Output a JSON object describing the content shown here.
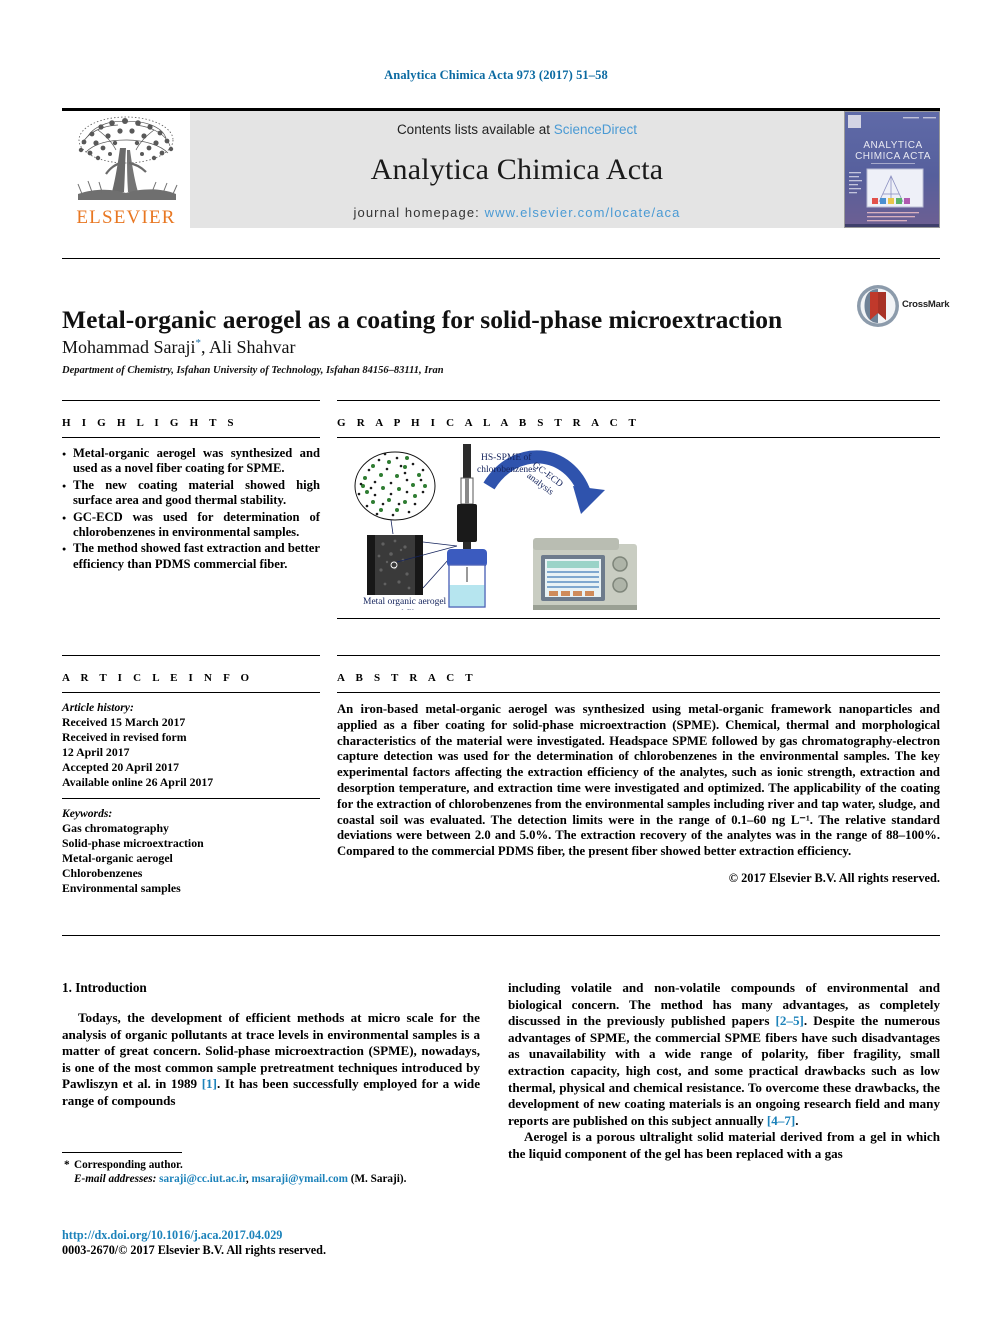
{
  "running_head": "Analytica Chimica Acta 973 (2017) 51–58",
  "masthead": {
    "publisher": "ELSEVIER",
    "contents_prefix": "Contents lists available at ",
    "contents_link": "ScienceDirect",
    "journal_title": "Analytica Chimica Acta",
    "homepage_prefix": "journal homepage: ",
    "homepage_url": "www.elsevier.com/locate/aca",
    "cover_title_line1": "ANALYTICA",
    "cover_title_line2": "CHIMICA ACTA"
  },
  "title": "Metal-organic aerogel as a coating for solid-phase microextraction",
  "authors": "Mohammad Saraji",
  "authors_rest": ", Ali Shahvar",
  "author_marker": "*",
  "affiliation": "Department of Chemistry, Isfahan University of Technology, Isfahan 84156–83111, Iran",
  "crossmark": {
    "label": "CrossMark"
  },
  "sections": {
    "highlights": "H I G H L I G H T S",
    "graphical_abstract": "G R A P H I C A L   A B S T R A C T",
    "article_info": "A R T I C L E   I N F O",
    "abstract": "A B S T R A C T"
  },
  "highlights": [
    "Metal-organic aerogel was synthesized and used as a novel fiber coating for SPME.",
    "The new coating material showed high surface area and good thermal stability.",
    "GC-ECD was used for determination of chlorobenzenes in environmental samples.",
    "The method showed fast extraction and better efficiency than PDMS commercial fiber."
  ],
  "graphical_abstract_figure": {
    "label_hs_spme_line1": "HS-SPME of",
    "label_hs_spme_line2": "chlorobenzenes",
    "label_arrow_line1": "GC-ECD",
    "label_arrow_line2": "analysis",
    "label_fiber_line1": "Metal organic aerogel",
    "label_fiber_line2": "coated fiber"
  },
  "article_info": {
    "history_label": "Article history:",
    "history": [
      "Received 15 March 2017",
      "Received in revised form",
      "12 April 2017",
      "Accepted 20 April 2017",
      "Available online 26 April 2017"
    ],
    "keywords_label": "Keywords:",
    "keywords": [
      "Gas chromatography",
      "Solid-phase microextraction",
      "Metal-organic aerogel",
      "Chlorobenzenes",
      "Environmental samples"
    ]
  },
  "abstract": {
    "text": "An iron-based metal-organic aerogel was synthesized using metal-organic framework nanoparticles and applied as a fiber coating for solid-phase microextraction (SPME). Chemical, thermal and morphological characteristics of the material were investigated. Headspace SPME followed by gas chromatography-electron capture detection was used for the determination of chlorobenzenes in the environmental samples. The key experimental factors affecting the extraction efficiency of the analytes, such as ionic strength, extraction and desorption temperature, and extraction time were investigated and optimized. The applicability of the coating for the extraction of chlorobenzenes from the environmental samples including river and tap water, sludge, and coastal soil was evaluated. The detection limits were in the range of 0.1–60 ng L⁻¹. The relative standard deviations were between 2.0 and 5.0%. The extraction recovery of the analytes was in the range of 88–100%. Compared to the commercial PDMS fiber, the present fiber showed better extraction efficiency.",
    "copyright": "© 2017 Elsevier B.V. All rights reserved."
  },
  "body": {
    "intro_heading": "1. Introduction",
    "left_para_1_a": "Todays, the development of efficient methods at micro scale for the analysis of organic pollutants at trace levels in environmental samples is a matter of great concern. Solid-phase microextraction (SPME), nowadays, is one of the most common sample pretreatment techniques introduced by Pawliszyn et al. in 1989 ",
    "left_cite_1": "[1]",
    "left_para_1_b": ". It has been successfully employed for a wide range of compounds",
    "right_para_1_a": "including volatile and non-volatile compounds of environmental and biological concern. The method has many advantages, as completely discussed in the previously published papers ",
    "right_cite_1": "[2–5]",
    "right_para_1_b": ". Despite the numerous advantages of SPME, the commercial SPME fibers have such disadvantages as unavailability with a wide range of polarity, fiber fragility, small extraction capacity, high cost, and some practical drawbacks such as low thermal, physical and chemical resistance. To overcome these drawbacks, the development of new coating materials is an ongoing research field and many reports are published on this subject annually ",
    "right_cite_2": "[4–7]",
    "right_para_1_c": ".",
    "right_para_2": "Aerogel is a porous ultralight solid material derived from a gel in which the liquid component of the gel has been replaced with a gas"
  },
  "footnote": {
    "corresponding": "Corresponding author.",
    "email_label": "E-mail addresses:",
    "email_1": "saraji@cc.iut.ac.ir",
    "email_sep": ", ",
    "email_2": "msaraji@ymail.com",
    "email_suffix": " (M. Saraji)."
  },
  "doi": "http://dx.doi.org/10.1016/j.aca.2017.04.029",
  "issn_line": "0003-2670/© 2017 Elsevier B.V. All rights reserved."
}
